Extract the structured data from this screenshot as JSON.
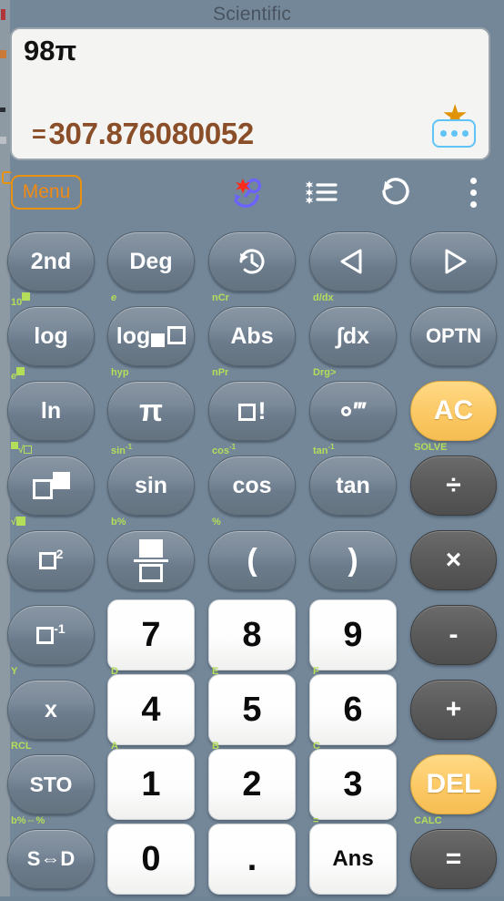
{
  "window": {
    "title": "Scientific"
  },
  "display": {
    "expression": "98π",
    "result_prefix": "=",
    "result": "307.876080052",
    "favorite_icon": "star-icon",
    "more_icon": "ellipsis-icon"
  },
  "toolbar": {
    "menu_label": "Menu",
    "icons": [
      {
        "name": "bookmark-search-icon"
      },
      {
        "name": "list-star-icon"
      },
      {
        "name": "undo-icon"
      },
      {
        "name": "overflow-menu-icon"
      }
    ]
  },
  "keypad": {
    "rows": [
      {
        "shifts": [
          "10■",
          "e▪",
          "nCr",
          "d/dx",
          ""
        ],
        "keys": [
          {
            "label": "2nd",
            "style": "fn",
            "name": "second-function-key"
          },
          {
            "label": "Deg",
            "style": "fn",
            "name": "degree-mode-key"
          },
          {
            "label": "",
            "style": "fn",
            "name": "history-key",
            "icon": "history-icon"
          },
          {
            "label": "",
            "style": "fn",
            "name": "cursor-left-key",
            "icon": "triangle-left-icon"
          },
          {
            "label": "",
            "style": "fn",
            "name": "cursor-right-key",
            "icon": "triangle-right-icon"
          }
        ]
      },
      {
        "shifts": [
          "e▪",
          "hyp",
          "nPr",
          "Drg>",
          ""
        ],
        "keys": [
          {
            "label": "log",
            "style": "fn",
            "name": "log-key"
          },
          {
            "label": "",
            "style": "fn",
            "name": "log-base-key",
            "icon": "log-subscript-icon"
          },
          {
            "label": "Abs",
            "style": "fn",
            "name": "abs-key"
          },
          {
            "label": "∫dx",
            "style": "fn",
            "name": "integral-key"
          },
          {
            "label": "OPTN",
            "style": "fn",
            "name": "optn-key"
          }
        ]
      },
      {
        "shifts": [
          "■√□",
          "sin-1",
          "cos-1",
          "tan-1",
          "SOLVE"
        ],
        "keys": [
          {
            "label": "ln",
            "style": "fn",
            "name": "ln-key"
          },
          {
            "label": "π",
            "style": "fn",
            "name": "pi-key"
          },
          {
            "label": "",
            "style": "fn",
            "name": "factorial-key",
            "icon": "box-factorial-icon"
          },
          {
            "label": "",
            "style": "fn",
            "name": "dms-key",
            "icon": "degrees-minutes-seconds-icon"
          },
          {
            "label": "AC",
            "style": "amber",
            "name": "all-clear-key"
          }
        ]
      },
      {
        "shifts": [
          "√■",
          "b%",
          "%",
          "",
          ""
        ],
        "keys": [
          {
            "label": "",
            "style": "fn",
            "name": "power-key",
            "icon": "box-power-icon"
          },
          {
            "label": "sin",
            "style": "fn",
            "name": "sin-key"
          },
          {
            "label": "cos",
            "style": "fn",
            "name": "cos-key"
          },
          {
            "label": "tan",
            "style": "fn",
            "name": "tan-key"
          },
          {
            "label": "÷",
            "style": "op",
            "name": "divide-key"
          }
        ]
      },
      {
        "shifts": [
          "",
          "",
          "",
          "",
          ""
        ],
        "keys": [
          {
            "label": "",
            "style": "fn",
            "name": "square-key",
            "icon": "box-squared-icon"
          },
          {
            "label": "",
            "style": "fn",
            "name": "fraction-key",
            "icon": "fraction-icon"
          },
          {
            "label": "(",
            "style": "fn",
            "name": "open-paren-key"
          },
          {
            "label": ")",
            "style": "fn",
            "name": "close-paren-key"
          },
          {
            "label": "×",
            "style": "op",
            "name": "multiply-key"
          }
        ]
      },
      {
        "shifts": [
          "Y",
          "D",
          "E",
          "F",
          ""
        ],
        "keys": [
          {
            "label": "",
            "style": "fn",
            "name": "reciprocal-key",
            "icon": "box-inverse-icon"
          },
          {
            "label": "7",
            "style": "num",
            "name": "digit-7-key"
          },
          {
            "label": "8",
            "style": "num",
            "name": "digit-8-key"
          },
          {
            "label": "9",
            "style": "num",
            "name": "digit-9-key"
          },
          {
            "label": "-",
            "style": "op",
            "name": "minus-key"
          }
        ]
      },
      {
        "shifts": [
          "RCL",
          "A",
          "B",
          "C",
          ""
        ],
        "keys": [
          {
            "label": "x",
            "style": "fn",
            "name": "variable-x-key"
          },
          {
            "label": "4",
            "style": "num",
            "name": "digit-4-key"
          },
          {
            "label": "5",
            "style": "num",
            "name": "digit-5-key"
          },
          {
            "label": "6",
            "style": "num",
            "name": "digit-6-key"
          },
          {
            "label": "+",
            "style": "op",
            "name": "plus-key"
          }
        ]
      },
      {
        "shifts": [
          "b%⇔%",
          "",
          "",
          "=",
          "CALC"
        ],
        "keys": [
          {
            "label": "STO",
            "style": "fn",
            "name": "store-key"
          },
          {
            "label": "1",
            "style": "num",
            "name": "digit-1-key"
          },
          {
            "label": "2",
            "style": "num",
            "name": "digit-2-key"
          },
          {
            "label": "3",
            "style": "num",
            "name": "digit-3-key"
          },
          {
            "label": "DEL",
            "style": "amber",
            "name": "delete-key"
          }
        ]
      },
      {
        "shifts": [
          "",
          "",
          "",
          "",
          ""
        ],
        "keys": [
          {
            "label": "S⇔D",
            "style": "fn",
            "name": "standard-decimal-toggle-key"
          },
          {
            "label": "0",
            "style": "num",
            "name": "digit-0-key"
          },
          {
            "label": ".",
            "style": "num",
            "name": "decimal-point-key"
          },
          {
            "label": "Ans",
            "style": "num",
            "name": "answer-key"
          },
          {
            "label": "=",
            "style": "op",
            "name": "equals-key"
          }
        ]
      }
    ]
  },
  "colors": {
    "background": "#738799",
    "accent_orange": "#f08a12",
    "shift_green": "#b4dd5a",
    "result_brown": "#8a4f29",
    "amber_key": "#fcca68",
    "star_gold": "#e09308",
    "more_blue": "#5fc4f5"
  }
}
